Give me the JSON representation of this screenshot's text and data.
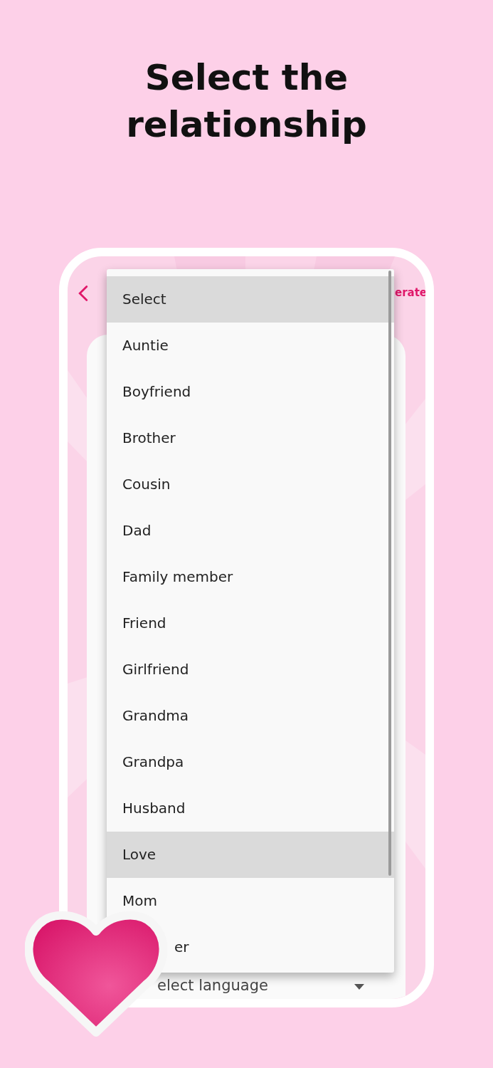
{
  "title": "Select the relationship",
  "top_bar": {
    "action_label": "erate"
  },
  "dropdown": {
    "items": [
      {
        "label": "Select",
        "highlighted": true
      },
      {
        "label": "Auntie",
        "highlighted": false
      },
      {
        "label": "Boyfriend",
        "highlighted": false
      },
      {
        "label": "Brother",
        "highlighted": false
      },
      {
        "label": "Cousin",
        "highlighted": false
      },
      {
        "label": "Dad",
        "highlighted": false
      },
      {
        "label": "Family member",
        "highlighted": false
      },
      {
        "label": "Friend",
        "highlighted": false
      },
      {
        "label": "Girlfriend",
        "highlighted": false
      },
      {
        "label": "Grandma",
        "highlighted": false
      },
      {
        "label": "Grandpa",
        "highlighted": false
      },
      {
        "label": "Husband",
        "highlighted": false
      },
      {
        "label": "Love",
        "highlighted": true
      },
      {
        "label": "Mom",
        "highlighted": false
      },
      {
        "label": "er",
        "highlighted": false,
        "covered": true
      }
    ]
  },
  "language_field": {
    "value": "elect language"
  }
}
